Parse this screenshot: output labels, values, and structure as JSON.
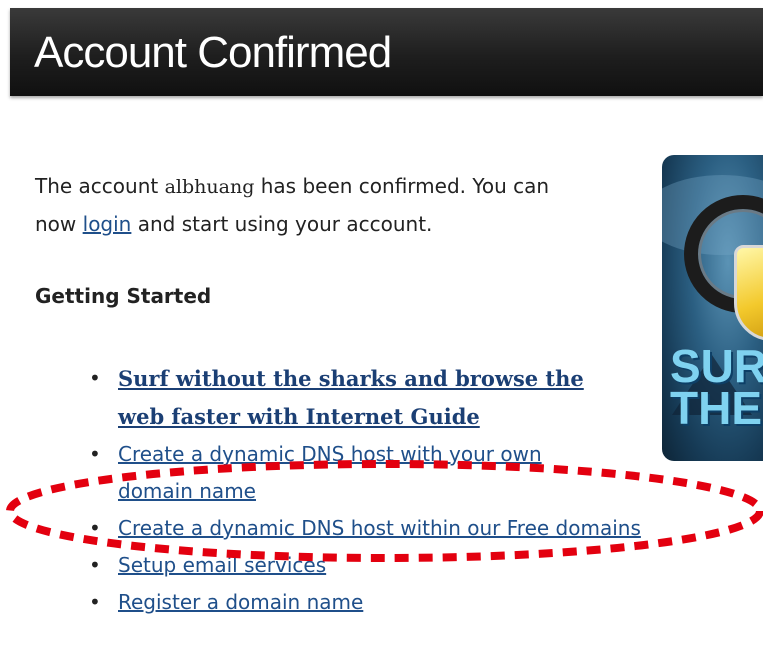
{
  "header": {
    "title": "Account Confirmed"
  },
  "intro": {
    "text_before_user": "The account ",
    "username": "albhuang",
    "text_after_user": " has been confirmed. You can now ",
    "login_link": "login",
    "text_after_login": " and start using your account."
  },
  "getting_started": {
    "heading": "Getting Started",
    "items": [
      {
        "label": "Surf without the sharks and browse the web faster with Internet Guide",
        "featured": true
      },
      {
        "label": "Create a dynamic DNS host with your own domain name",
        "featured": false
      },
      {
        "label": "Create a dynamic DNS host within our Free domains",
        "featured": false
      },
      {
        "label": "Setup email services",
        "featured": false
      },
      {
        "label": "Register a domain name",
        "featured": false
      }
    ]
  },
  "promo": {
    "text_line1": "SUR",
    "text_line2": "THE"
  },
  "colors": {
    "link": "#1f4f8a",
    "annotation": "#e3000f",
    "header_bg": "#1e1e1e"
  }
}
